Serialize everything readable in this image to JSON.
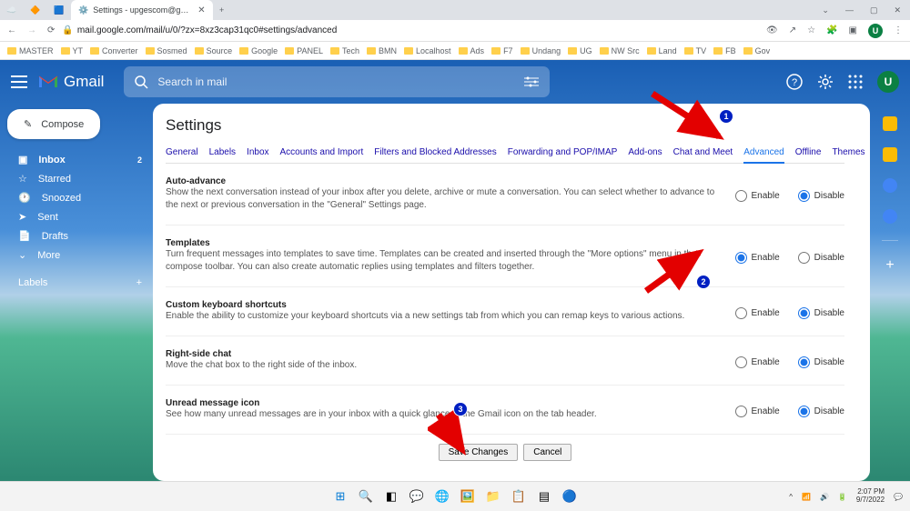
{
  "browser": {
    "tab_title": "Settings - upgescom@gmail.com",
    "url": "mail.google.com/mail/u/0/?zx=8xz3cap31qc0#settings/advanced",
    "bookmarks": [
      "MASTER",
      "YT",
      "Converter",
      "Sosmed",
      "Source",
      "Google",
      "PANEL",
      "Tech",
      "BMN",
      "Localhost",
      "Ads",
      "F7",
      "Undang",
      "UG",
      "NW Src",
      "Land",
      "TV",
      "FB",
      "Gov"
    ]
  },
  "gmail": {
    "brand": "Gmail",
    "search_placeholder": "Search in mail",
    "compose": "Compose",
    "nav": [
      {
        "label": "Inbox",
        "count": "2",
        "icon": "inbox"
      },
      {
        "label": "Starred",
        "icon": "star"
      },
      {
        "label": "Snoozed",
        "icon": "clock"
      },
      {
        "label": "Sent",
        "icon": "send"
      },
      {
        "label": "Drafts",
        "icon": "draft"
      },
      {
        "label": "More",
        "icon": "more"
      }
    ],
    "labels_header": "Labels",
    "avatar_letter": "U"
  },
  "settings": {
    "title": "Settings",
    "tabs": [
      "General",
      "Labels",
      "Inbox",
      "Accounts and Import",
      "Filters and Blocked Addresses",
      "Forwarding and POP/IMAP",
      "Add-ons",
      "Chat and Meet",
      "Advanced",
      "Offline",
      "Themes"
    ],
    "active_tab": "Advanced",
    "enable_label": "Enable",
    "disable_label": "Disable",
    "rows": [
      {
        "title": "Auto-advance",
        "desc": "Show the next conversation instead of your inbox after you delete, archive or mute a conversation. You can select whether to advance to the next or previous conversation in the \"General\" Settings page.",
        "value": "disable"
      },
      {
        "title": "Templates",
        "desc": "Turn frequent messages into templates to save time. Templates can be created and inserted through the \"More options\" menu in the compose toolbar. You can also create automatic replies using templates and filters together.",
        "value": "enable"
      },
      {
        "title": "Custom keyboard shortcuts",
        "desc": "Enable the ability to customize your keyboard shortcuts via a new settings tab from which you can remap keys to various actions.",
        "value": "disable"
      },
      {
        "title": "Right-side chat",
        "desc": "Move the chat box to the right side of the inbox.",
        "value": "disable"
      },
      {
        "title": "Unread message icon",
        "desc": "See how many unread messages are in your inbox with a quick glance at the Gmail icon on the tab header.",
        "value": "disable"
      }
    ],
    "save_btn": "Save Changes",
    "cancel_btn": "Cancel"
  },
  "taskbar": {
    "time": "2:07 PM",
    "date": "9/7/2022"
  }
}
